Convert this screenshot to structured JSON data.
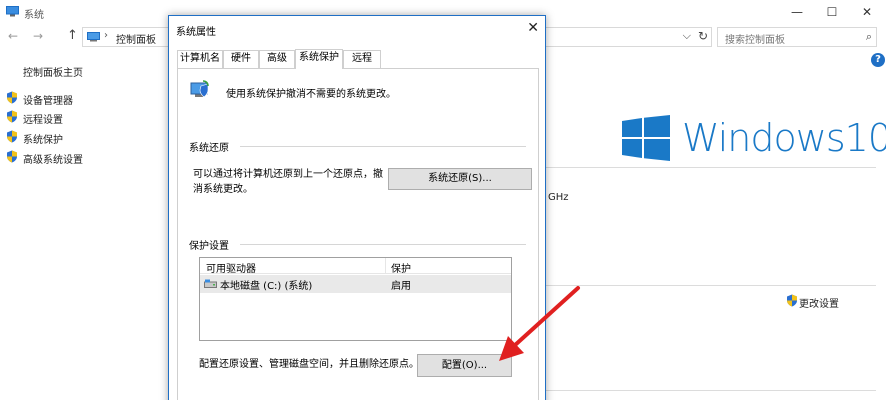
{
  "background_window": {
    "title": "系统",
    "minimize": "—",
    "maximize": "☐",
    "close": "✕",
    "nav_back": "←",
    "nav_forward": "→",
    "nav_up": "↑",
    "address_sep": "›",
    "address_crumb": "控制面板",
    "address_chevron": "⌵",
    "address_refresh": "↻",
    "search_placeholder": "搜索控制面板",
    "search_icon": "⌕",
    "help_label": "?",
    "left_nav_home": "控制面板主页",
    "left_nav_items": [
      {
        "label": "设备管理器",
        "icon": "shield-icon"
      },
      {
        "label": "远程设置",
        "icon": "shield-icon"
      },
      {
        "label": "系统保护",
        "icon": "shield-icon"
      },
      {
        "label": "高级系统设置",
        "icon": "shield-icon"
      }
    ],
    "windows_brand": "Windows10",
    "processor_fragment": "GHz",
    "change_settings": "更改设置"
  },
  "dialog": {
    "title": "系统属性",
    "close": "✕",
    "tabs": [
      {
        "label": "计算机名",
        "active": false
      },
      {
        "label": "硬件",
        "active": false
      },
      {
        "label": "高级",
        "active": false
      },
      {
        "label": "系统保护",
        "active": true
      },
      {
        "label": "远程",
        "active": false
      }
    ],
    "description": "使用系统保护撤消不需要的系统更改。",
    "restore_group": {
      "title": "系统还原",
      "text": "可以通过将计算机还原到上一个还原点，撤消系统更改。",
      "button": "系统还原(S)..."
    },
    "protection_group": {
      "title": "保护设置",
      "columns": [
        "可用驱动器",
        "保护"
      ],
      "rows": [
        {
          "drive": "本地磁盘 (C:) (系统)",
          "protection": "启用"
        }
      ],
      "config_text": "配置还原设置、管理磁盘空间，并且删除还原点。",
      "config_button": "配置(O)..."
    }
  },
  "colors": {
    "accent": "#1f6fc5",
    "windows_blue": "#1a79c7",
    "annotation_arrow": "#e02020"
  }
}
